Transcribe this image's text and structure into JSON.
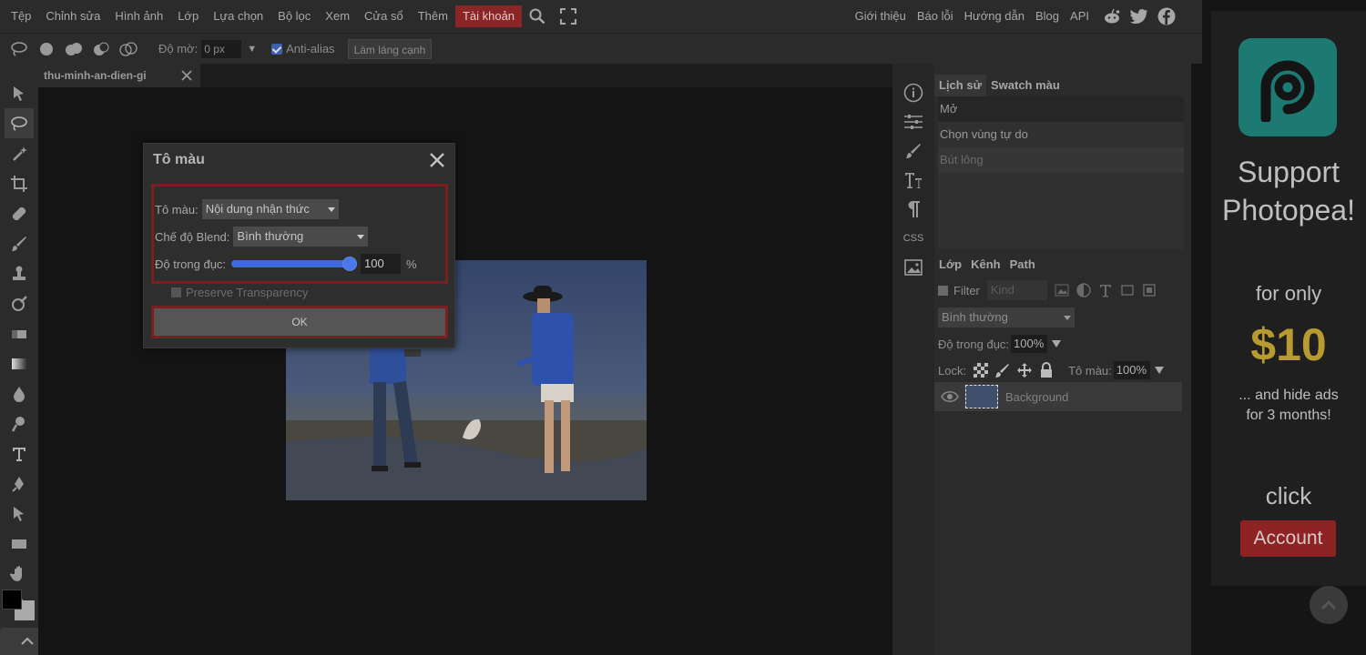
{
  "menu": {
    "items": [
      "Tệp",
      "Chỉnh sửa",
      "Hình ảnh",
      "Lớp",
      "Lựa chọn",
      "Bộ lọc",
      "Xem",
      "Cửa sổ",
      "Thêm",
      "Tài khoản"
    ],
    "right_items": [
      "Giới thiệu",
      "Báo lỗi",
      "Hướng dẫn",
      "Blog",
      "API"
    ],
    "active_item": "Tài khoản",
    "social_icons": [
      "reddit-icon",
      "twitter-icon",
      "facebook-icon"
    ]
  },
  "options_bar": {
    "feather_label": "Độ mờ:",
    "feather_value": "0 px",
    "antialias_label": "Anti-alias",
    "antialias_checked": true,
    "refine_edge_label": "Làm láng cạnh"
  },
  "document": {
    "tab_title": "thu-minh-an-dien-gi"
  },
  "dialog": {
    "title": "Tô màu",
    "fill_label": "Tô màu:",
    "fill_value": "Nội dung nhận thức",
    "blend_label": "Chế độ Blend:",
    "blend_value": "Bình thường",
    "opacity_label": "Độ trong đục:",
    "opacity_value": "100",
    "opacity_unit": "%",
    "opacity_fraction": 1.0,
    "preserve_label": "Preserve Transparency",
    "preserve_checked": false,
    "ok_label": "OK"
  },
  "icon_strip": {
    "css_label": "CSS"
  },
  "panels": {
    "history_tabs": [
      "Lịch sử",
      "Swatch màu"
    ],
    "history_items": [
      "Mở",
      "Chọn vùng tự do",
      "Bút lông"
    ],
    "layer_tabs": [
      "Lớp",
      "Kênh",
      "Path"
    ],
    "filter_label": "Filter",
    "kind_value": "Kind",
    "blend_mode": "Bình thường",
    "opacity_label": "Độ trong đục:",
    "opacity_value": "100%",
    "lock_label": "Lock:",
    "fill_label": "Tô màu:",
    "fill_value": "100%",
    "layer_name": "Background"
  },
  "ad": {
    "support_line1": "Support",
    "support_line2": "Photopea!",
    "for_only": "for only",
    "price": "$10",
    "hide_line1": "... and hide ads",
    "hide_line2": "for 3 months!",
    "click": "click",
    "account_button": "Account"
  },
  "colors": {
    "accent_red": "#8c2525",
    "slider_blue": "#3f6ad8",
    "ad_logo_teal": "#1c7a72",
    "price_gold": "#b99a30"
  }
}
